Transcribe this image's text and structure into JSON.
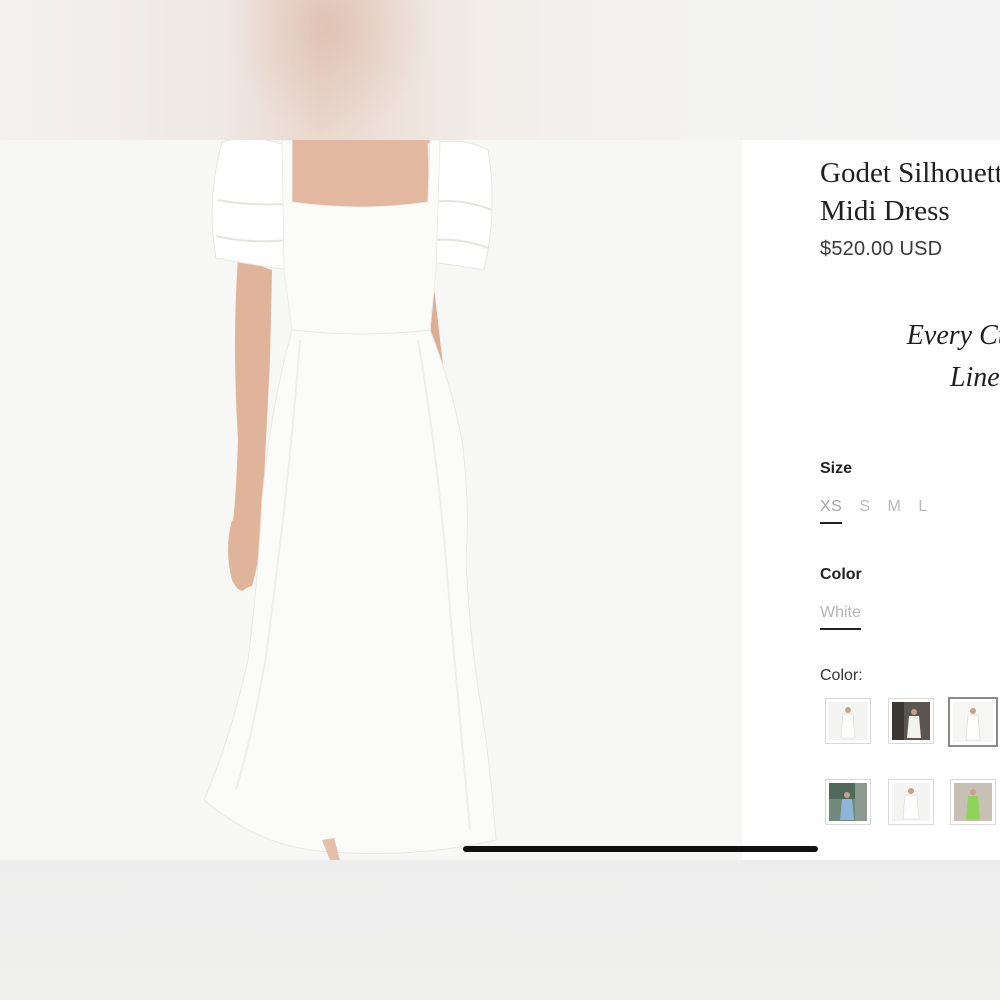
{
  "product": {
    "title_line1": "Godet Silhouette",
    "title_line2": "Midi Dress",
    "price": "$520.00 USD",
    "tagline_line1": "Every Curve C",
    "tagline_line2": "Line In"
  },
  "size": {
    "label": "Size",
    "options": [
      "XS",
      "S",
      "M",
      "L"
    ],
    "selected": "XS"
  },
  "color": {
    "label": "Color",
    "selected_value": "White",
    "swatches_label": "Color:",
    "swatch_count": 6,
    "selected_swatch_index": 2
  },
  "colors": {
    "panel_background": "#ffffff",
    "photo_background": "#f7f7f6",
    "dress": "#fbfbf9",
    "skin": "#e2b8a0",
    "text_dark": "#1f1f1f",
    "muted": "#b9b9b9"
  },
  "icons": {
    "home_indicator": "home-indicator-bar"
  }
}
